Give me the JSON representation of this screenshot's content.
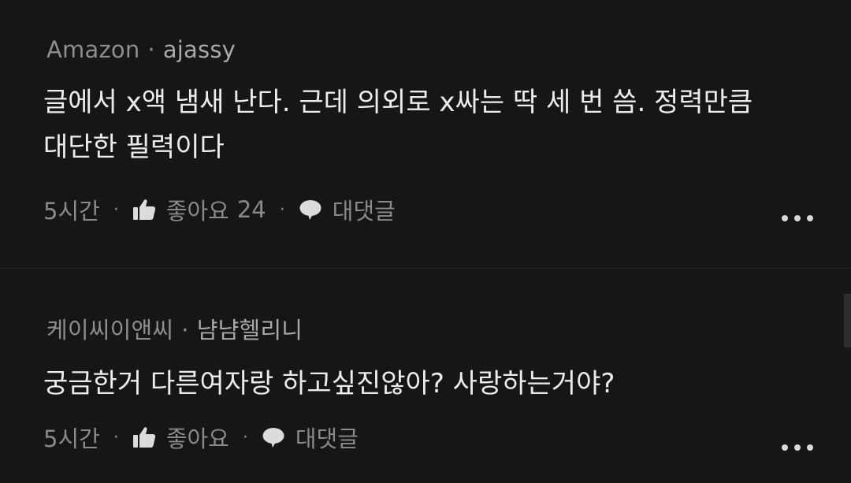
{
  "comments": [
    {
      "company": "Amazon",
      "separator": "·",
      "author": "ajassy",
      "text_lines": [
        "글에서 x액 냄새 난다. 근데 의외로 x싸는 딱 세 번 씀. 정력만큼",
        "대단한 필력이다"
      ],
      "time": "5시간",
      "like_label": "좋아요",
      "like_count": "24",
      "reply_label": "대댓글"
    },
    {
      "company": "케이씨이앤씨",
      "separator": "·",
      "author": "냠냠헬리니",
      "text_lines": [
        "궁금한거 다른여자랑 하고싶진않아? 사랑하는거야?"
      ],
      "time": "5시간",
      "like_label": "좋아요",
      "like_count": "",
      "reply_label": "대댓글"
    }
  ],
  "action_separator": "·",
  "icons": {
    "like": "thumbs-up-icon",
    "reply": "speech-bubble-icon",
    "more": "more-horizontal-icon"
  }
}
